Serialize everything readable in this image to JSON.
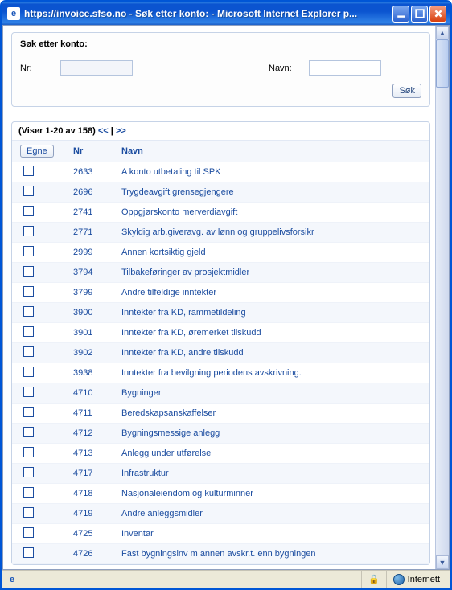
{
  "window": {
    "title": "https://invoice.sfso.no - Søk etter konto: - Microsoft Internet Explorer p..."
  },
  "search": {
    "heading": "Søk etter konto:",
    "nr_label": "Nr:",
    "navn_label": "Navn:",
    "nr_value": "",
    "navn_value": "",
    "submit_label": "Søk"
  },
  "results": {
    "range_text": "(Viser 1-20 av 158) ",
    "nav_prev": "<<",
    "nav_sep": " | ",
    "nav_next": ">>",
    "egne_label": "Egne",
    "col_nr": "Nr",
    "col_navn": "Navn",
    "rows": [
      {
        "nr": "2633",
        "navn": "A konto utbetaling til SPK"
      },
      {
        "nr": "2696",
        "navn": "Trygdeavgift grensegjengere"
      },
      {
        "nr": "2741",
        "navn": "Oppgjørskonto merverdiavgift"
      },
      {
        "nr": "2771",
        "navn": "Skyldig arb.giveravg. av lønn og gruppelivsforsikr"
      },
      {
        "nr": "2999",
        "navn": "Annen kortsiktig gjeld"
      },
      {
        "nr": "3794",
        "navn": "Tilbakeføringer av prosjektmidler"
      },
      {
        "nr": "3799",
        "navn": "Andre tilfeldige inntekter"
      },
      {
        "nr": "3900",
        "navn": "Inntekter fra KD, rammetildeling"
      },
      {
        "nr": "3901",
        "navn": "Inntekter fra KD, øremerket tilskudd"
      },
      {
        "nr": "3902",
        "navn": "Inntekter fra KD, andre tilskudd"
      },
      {
        "nr": "3938",
        "navn": "Inntekter fra bevilgning periodens avskrivning."
      },
      {
        "nr": "4710",
        "navn": "Bygninger"
      },
      {
        "nr": "4711",
        "navn": "Beredskapsanskaffelser"
      },
      {
        "nr": "4712",
        "navn": "Bygningsmessige anlegg"
      },
      {
        "nr": "4713",
        "navn": "Anlegg under utførelse"
      },
      {
        "nr": "4717",
        "navn": "Infrastruktur"
      },
      {
        "nr": "4718",
        "navn": "Nasjonaleiendom og kulturminner"
      },
      {
        "nr": "4719",
        "navn": "Andre anleggsmidler"
      },
      {
        "nr": "4725",
        "navn": "Inventar"
      },
      {
        "nr": "4726",
        "navn": "Fast bygningsinv m annen avskr.t. enn bygningen"
      }
    ]
  },
  "status": {
    "zone": "Internett"
  }
}
